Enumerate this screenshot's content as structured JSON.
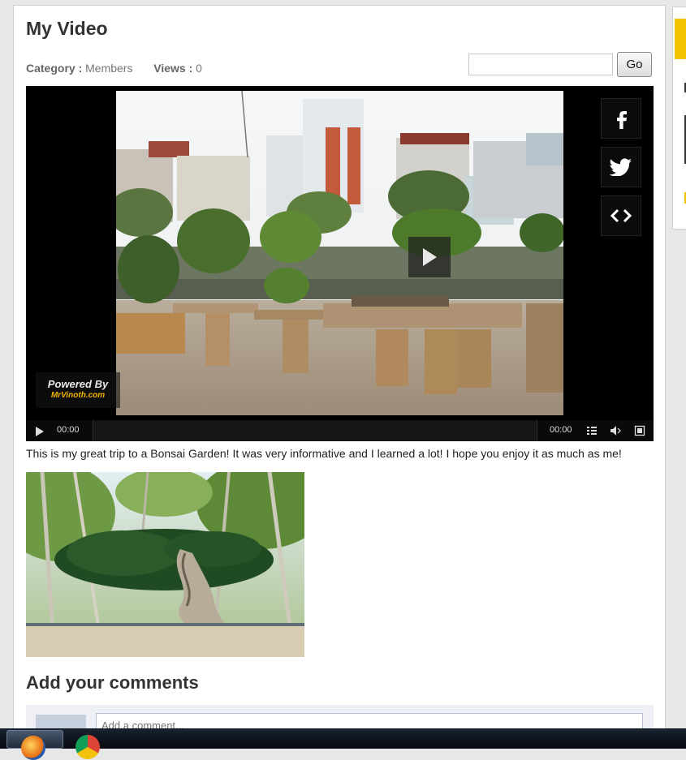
{
  "page": {
    "title": "My Video",
    "category_label": "Category :",
    "category_value": "Members",
    "views_label": "Views :",
    "views_value": "0"
  },
  "search": {
    "value": "",
    "placeholder": "",
    "button_label": "Go"
  },
  "player": {
    "current_time": "00:00",
    "duration": "00:00",
    "watermark_line1": "Powered By",
    "watermark_line2": "MrVinoth.com",
    "share_buttons": [
      "facebook-icon",
      "twitter-icon",
      "embed-code-icon"
    ],
    "center_icon": "play-icon"
  },
  "description": "This is my great trip to a Bonsai Garden! It was very informative and I learned a lot! I hope you enjoy it as much as me!",
  "comments": {
    "title": "Add your comments",
    "input_placeholder": "Add a comment...",
    "input_value": ""
  },
  "taskbar": {
    "apps": [
      "firefox-icon",
      "chrome-icon"
    ]
  },
  "colors": {
    "accent": "#f5c200",
    "watermark_link": "#f0b400",
    "player_bg": "#000000"
  }
}
